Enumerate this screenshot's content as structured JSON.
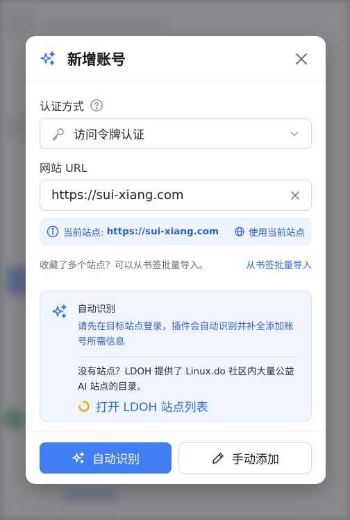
{
  "dialog": {
    "title": "新增账号"
  },
  "auth": {
    "label": "认证方式",
    "value": "访问令牌认证"
  },
  "url": {
    "label": "网站 URL",
    "value": "https://sui-xiang.com"
  },
  "current_site": {
    "prefix": "当前站点:",
    "url": "https://sui-xiang.com",
    "use_label": "使用当前站点"
  },
  "bookmark": {
    "text": "收藏了多个站点？可以从书签批量导入。",
    "link": "从书签批量导入"
  },
  "auto_detect": {
    "title": "自动识别",
    "description": "请先在目标站点登录，插件会自动识别并补全添加账号所需信息",
    "ldoh_text": "没有站点？LDOH 提供了 Linux.do 社区内大量公益 AI 站点的目录。",
    "ldoh_link": "打开 LDOH 站点列表"
  },
  "footer": {
    "auto_label": "自动识别",
    "manual_label": "手动添加"
  },
  "colors": {
    "primary": "#3f7ff3",
    "link": "#2d6ee6",
    "info_bg": "#eef4fd"
  }
}
